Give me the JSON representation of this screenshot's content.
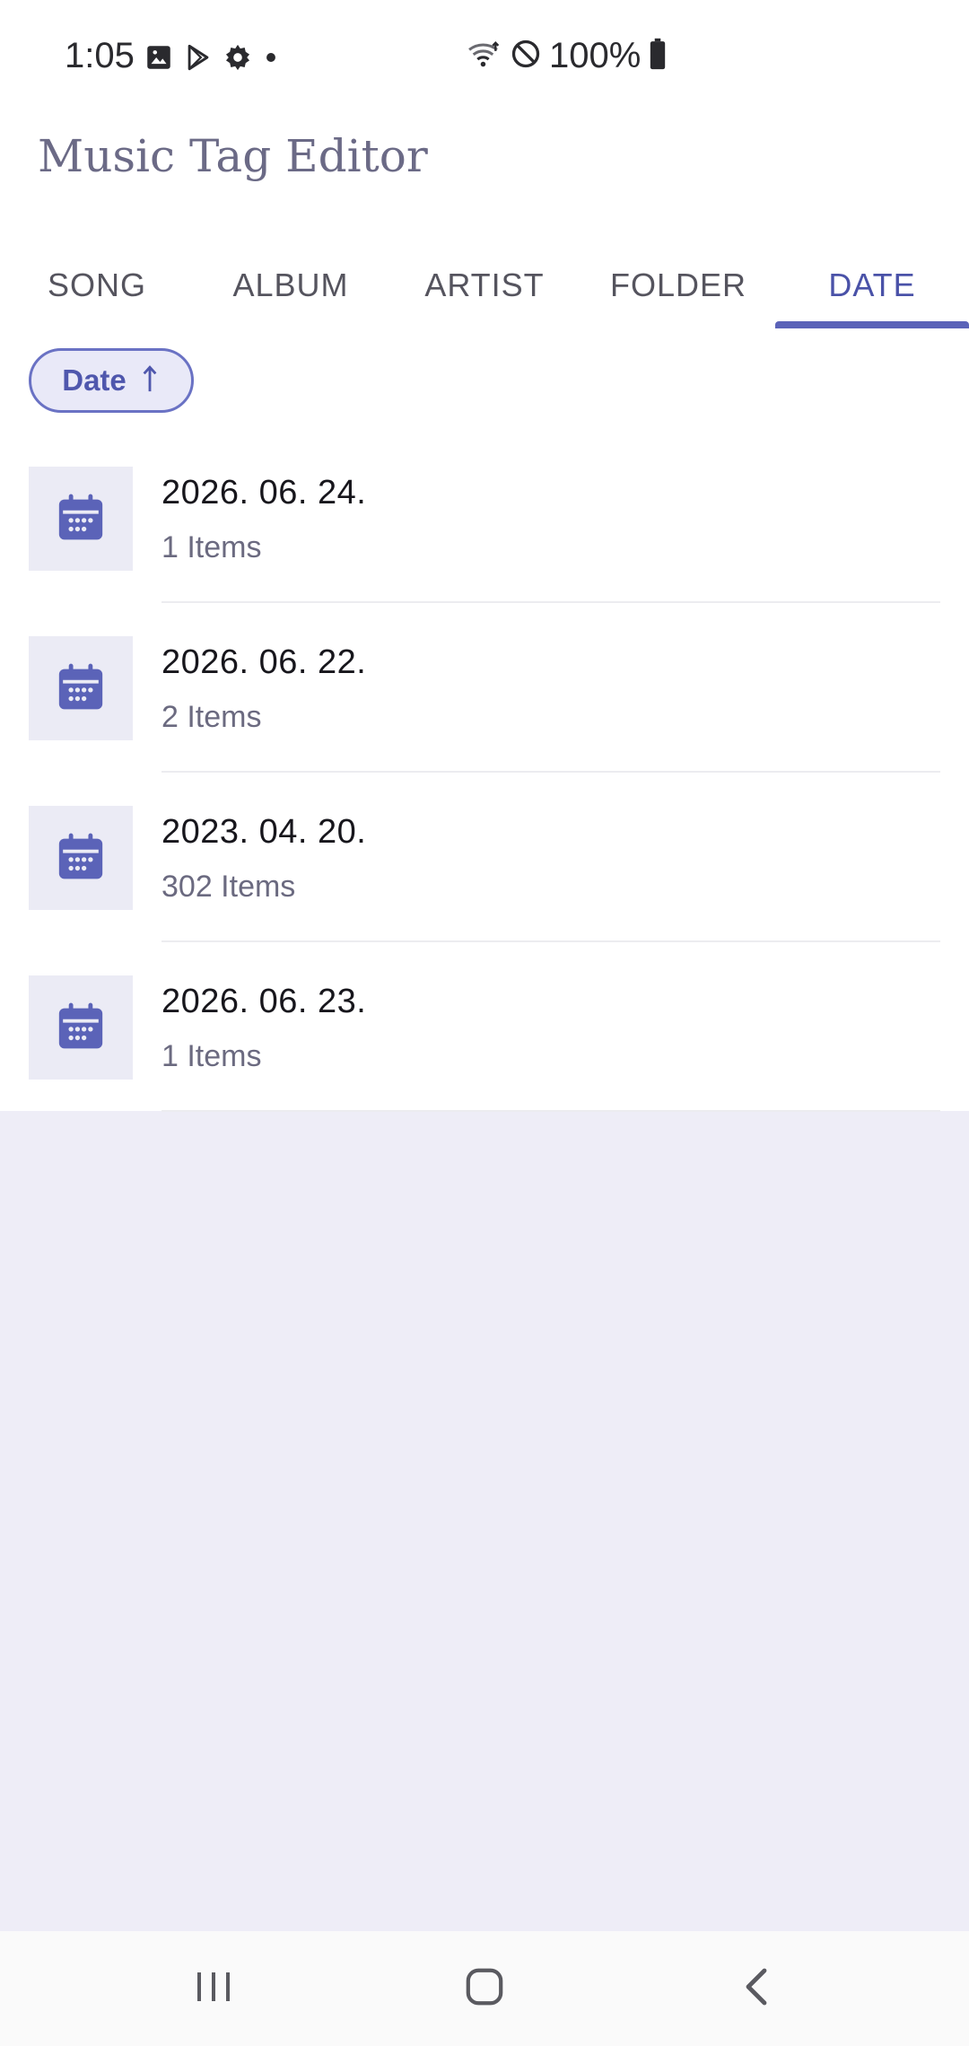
{
  "status_bar": {
    "time": "1:05",
    "battery": "100%",
    "icons": [
      "image-icon",
      "play-store-icon",
      "gear-icon",
      "dot-icon",
      "wifi-icon",
      "do-not-disturb-icon",
      "battery-icon"
    ]
  },
  "app": {
    "title": "Music Tag Editor"
  },
  "tabs": [
    {
      "label": "SONG",
      "active": false
    },
    {
      "label": "ALBUM",
      "active": false
    },
    {
      "label": "ARTIST",
      "active": false
    },
    {
      "label": "FOLDER",
      "active": false
    },
    {
      "label": "DATE",
      "active": true
    }
  ],
  "sort": {
    "label": "Date",
    "direction": "ascending",
    "icon": "arrow-up-icon"
  },
  "list": [
    {
      "date": "2026. 06. 24.",
      "count": "1 Items",
      "icon": "calendar-icon"
    },
    {
      "date": "2026. 06. 22.",
      "count": "2 Items",
      "icon": "calendar-icon"
    },
    {
      "date": "2023. 04. 20.",
      "count": "302 Items",
      "icon": "calendar-icon"
    },
    {
      "date": "2026. 06. 23.",
      "count": "1 Items",
      "icon": "calendar-icon"
    }
  ],
  "nav_bar": {
    "buttons": [
      "recents-icon",
      "home-icon",
      "back-icon"
    ]
  },
  "colors": {
    "accent": "#5b63b8",
    "active_tab_text": "#4a52a8",
    "empty_background": "#eeedf7",
    "title": "#6b6a86"
  }
}
